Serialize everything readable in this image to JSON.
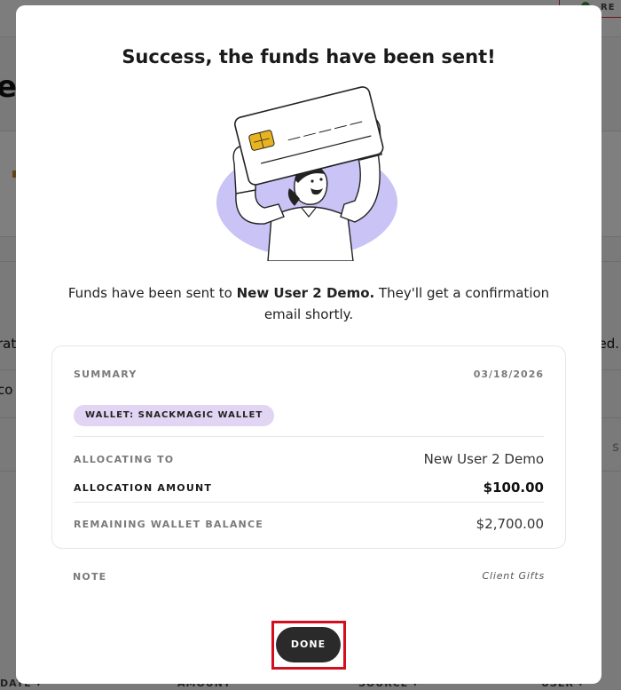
{
  "background": {
    "top_button_label": "RE",
    "title_fragment": "et",
    "left_fragment_1": "rat",
    "left_fragment_2": "co",
    "right_fragment_1": "ed.",
    "right_fragment_2": "s",
    "column_headers": [
      "DATE ▾",
      "AMOUNT",
      "SOURCE ▾",
      "USER ▾"
    ]
  },
  "modal": {
    "title": "Success, the funds have been sent!",
    "illustration": "person-holding-card-illustration",
    "message_prefix": "Funds have been sent to ",
    "message_recipient": "New User 2 Demo.",
    "message_suffix": " They'll get a confirmation email shortly.",
    "summary": {
      "label": "SUMMARY",
      "date": "03/18/2026",
      "wallet_badge": "WALLET: SNACKMAGIC WALLET",
      "rows": [
        {
          "label": "ALLOCATING TO",
          "value": "New User 2 Demo"
        },
        {
          "label": "ALLOCATION AMOUNT",
          "value": "$100.00"
        },
        {
          "label": "REMAINING WALLET BALANCE",
          "value": "$2,700.00"
        }
      ]
    },
    "note": {
      "label": "NOTE",
      "value": "Client Gifts"
    },
    "done_label": "DONE"
  },
  "colors": {
    "badge_bg": "#e2d4f3",
    "illustration_blob": "#c9c3f6",
    "card_chip": "#e8b320",
    "button_bg": "#2a2a2a",
    "highlight": "#d10f1f"
  }
}
